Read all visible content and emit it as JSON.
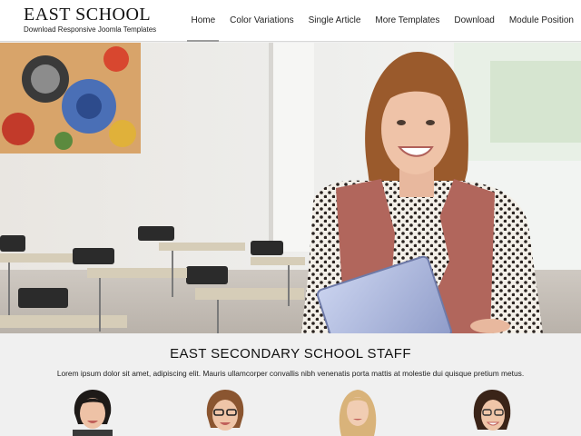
{
  "site": {
    "title": "EAST SCHOOL",
    "tagline": "Download Responsive Joomla Templates"
  },
  "nav": {
    "items": [
      {
        "label": "Home",
        "active": true
      },
      {
        "label": "Color Variations",
        "active": false
      },
      {
        "label": "Single Article",
        "active": false
      },
      {
        "label": "More Templates",
        "active": false
      },
      {
        "label": "Download",
        "active": false
      },
      {
        "label": "Module Position",
        "active": false
      }
    ]
  },
  "hero": {
    "image": "classroom-teacher-photo"
  },
  "staff": {
    "heading": "EAST SECONDARY SCHOOL STAFF",
    "description": "Lorem ipsum dolor sit amet, adipiscing elit. Mauris ullamcorper convallis nibh venenatis porta mattis at molestie dui quisque pretium metus.",
    "portraits": [
      {
        "image": "staff-portrait-dark-hair"
      },
      {
        "image": "staff-portrait-glasses"
      },
      {
        "image": "staff-portrait-blonde"
      },
      {
        "image": "staff-portrait-glasses-dark"
      }
    ]
  },
  "colors": {
    "header_bg": "#ffffff",
    "section_bg": "#f0f0f0",
    "active_underline": "#9c9c9c"
  }
}
